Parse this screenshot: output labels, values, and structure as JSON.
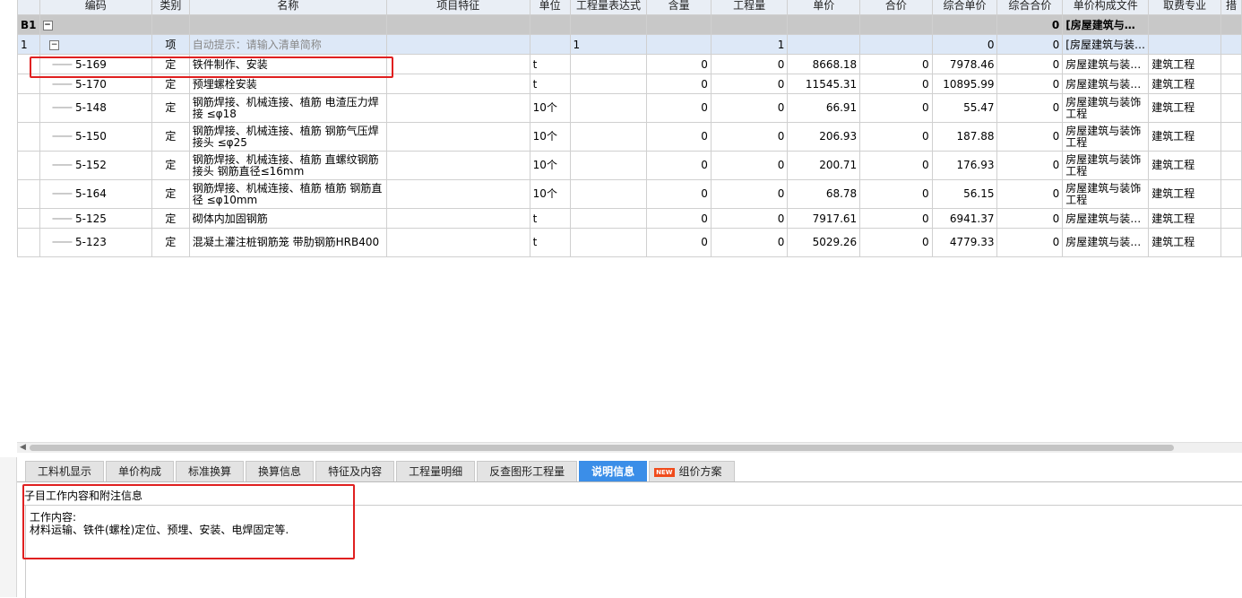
{
  "columns": [
    "编码",
    "类别",
    "名称",
    "项目特征",
    "单位",
    "工程量表达式",
    "含量",
    "工程量",
    "单价",
    "合价",
    "综合单价",
    "综合合价",
    "单价构成文件",
    "取费专业",
    "措"
  ],
  "b1": {
    "label": "B1",
    "zhhj": "0",
    "file": "[房屋建筑与…"
  },
  "item1": {
    "index": "1",
    "type": "项",
    "name_hint": "自动提示：请输入清单简称",
    "expr": "1",
    "qty": "1",
    "zhdj": "0",
    "zhhj": "0",
    "file": "[房屋建筑与装…"
  },
  "rows": [
    {
      "code": "5-169",
      "type": "定",
      "name": "铁件制作、安装",
      "unit": "t",
      "content": "0",
      "qty": "0",
      "price": "8668.18",
      "total": "0",
      "zhdj": "7978.46",
      "zhhj": "0",
      "file": "房屋建筑与装…",
      "major": "建筑工程"
    },
    {
      "code": "5-170",
      "type": "定",
      "name": "预埋螺栓安装",
      "unit": "t",
      "content": "0",
      "qty": "0",
      "price": "11545.31",
      "total": "0",
      "zhdj": "10895.99",
      "zhhj": "0",
      "file": "房屋建筑与装…",
      "major": "建筑工程"
    },
    {
      "code": "5-148",
      "type": "定",
      "name": "钢筋焊接、机械连接、植筋 电渣压力焊接 ≤φ18",
      "unit": "10个",
      "content": "0",
      "qty": "0",
      "price": "66.91",
      "total": "0",
      "zhdj": "55.47",
      "zhhj": "0",
      "file": "房屋建筑与装饰工程",
      "major": "建筑工程"
    },
    {
      "code": "5-150",
      "type": "定",
      "name": "钢筋焊接、机械连接、植筋 钢筋气压焊接头 ≤φ25",
      "unit": "10个",
      "content": "0",
      "qty": "0",
      "price": "206.93",
      "total": "0",
      "zhdj": "187.88",
      "zhhj": "0",
      "file": "房屋建筑与装饰工程",
      "major": "建筑工程"
    },
    {
      "code": "5-152",
      "type": "定",
      "name": "钢筋焊接、机械连接、植筋 直螺纹钢筋接头 钢筋直径≤16mm",
      "unit": "10个",
      "content": "0",
      "qty": "0",
      "price": "200.71",
      "total": "0",
      "zhdj": "176.93",
      "zhhj": "0",
      "file": "房屋建筑与装饰工程",
      "major": "建筑工程"
    },
    {
      "code": "5-164",
      "type": "定",
      "name": "钢筋焊接、机械连接、植筋 植筋 钢筋直径 ≤φ10mm",
      "unit": "10个",
      "content": "0",
      "qty": "0",
      "price": "68.78",
      "total": "0",
      "zhdj": "56.15",
      "zhhj": "0",
      "file": "房屋建筑与装饰工程",
      "major": "建筑工程"
    },
    {
      "code": "5-125",
      "type": "定",
      "name": "砌体内加固钢筋",
      "unit": "t",
      "content": "0",
      "qty": "0",
      "price": "7917.61",
      "total": "0",
      "zhdj": "6941.37",
      "zhhj": "0",
      "file": "房屋建筑与装…",
      "major": "建筑工程"
    },
    {
      "code": "5-123",
      "type": "定",
      "name": "混凝土灌注桩钢筋笼 带肋钢筋HRB400",
      "unit": "t",
      "content": "0",
      "qty": "0",
      "price": "5029.26",
      "total": "0",
      "zhdj": "4779.33",
      "zhhj": "0",
      "file": "房屋建筑与装…",
      "major": "建筑工程"
    }
  ],
  "tabs": [
    "工料机显示",
    "单价构成",
    "标准换算",
    "换算信息",
    "特征及内容",
    "工程量明细",
    "反查图形工程量",
    "说明信息",
    "组价方案"
  ],
  "new_badge": "NEW",
  "info": {
    "title": "子目工作内容和附注信息",
    "line1": "工作内容:",
    "line2": "材料运输、铁件(螺栓)定位、预埋、安装、电焊固定等."
  }
}
